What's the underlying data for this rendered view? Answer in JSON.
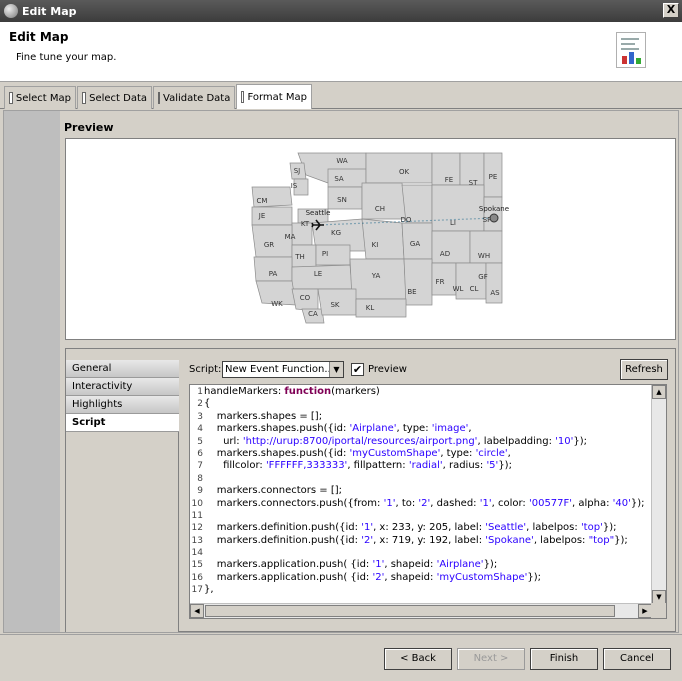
{
  "window": {
    "title": "Edit Map",
    "close_glyph": "X"
  },
  "header": {
    "title": "Edit Map",
    "subtitle": "Fine tune your map."
  },
  "tabs": [
    {
      "label": "Select Map",
      "icon": "select-map-icon"
    },
    {
      "label": "Select Data",
      "icon": "select-data-icon"
    },
    {
      "label": "Validate Data",
      "icon": "validate-data-icon"
    },
    {
      "label": "Format Map",
      "icon": "format-map-icon",
      "active": true
    }
  ],
  "preview": {
    "label": "Preview",
    "map": {
      "region_labels": [
        "WA",
        "SJ",
        "IS",
        "SA",
        "SN",
        "CM",
        "JE",
        "KT",
        "MA",
        "KG",
        "OK",
        "CH",
        "DO",
        "FE",
        "ST",
        "PE",
        "LI",
        "SP",
        "GR",
        "TH",
        "PI",
        "KI",
        "GA",
        "AD",
        "WH",
        "PA",
        "LE",
        "YA",
        "FR",
        "WL",
        "GF",
        "CL",
        "AS",
        "BE",
        "WK",
        "CO",
        "SK",
        "KL",
        "CA"
      ],
      "cities": [
        {
          "name": "Seattle",
          "marker": "airplane"
        },
        {
          "name": "Spokane",
          "marker": "circle"
        }
      ],
      "connector_color": "#00577F"
    }
  },
  "side_nav": {
    "items": [
      {
        "label": "General"
      },
      {
        "label": "Interactivity"
      },
      {
        "label": "Highlights"
      },
      {
        "label": "Script",
        "active": true
      }
    ]
  },
  "script": {
    "label": "Script:",
    "select_value": "New Event Function...",
    "preview_checked": true,
    "preview_label": "Preview",
    "refresh_label": "Refresh",
    "code_lines": [
      {
        "n": "1",
        "text": "handleMarkers: function(markers)"
      },
      {
        "n": "2",
        "text": "{"
      },
      {
        "n": "3",
        "text": "    markers.shapes = [];"
      },
      {
        "n": "4",
        "text": "    markers.shapes.push({id: 'Airplane', type: 'image',"
      },
      {
        "n": "5",
        "text": "      url: 'http://urup:8700/iportal/resources/airport.png', labelpadding: '10'});"
      },
      {
        "n": "6",
        "text": "    markers.shapes.push({id: 'myCustomShape', type: 'circle',"
      },
      {
        "n": "7",
        "text": "      fillcolor: 'FFFFFF,333333', fillpattern: 'radial', radius: '5'});"
      },
      {
        "n": "8",
        "text": ""
      },
      {
        "n": "9",
        "text": "    markers.connectors = [];"
      },
      {
        "n": "10",
        "text": "    markers.connectors.push({from: '1', to: '2', dashed: '1', color: '00577F', alpha: '40'});"
      },
      {
        "n": "11",
        "text": ""
      },
      {
        "n": "12",
        "text": "    markers.definition.push({id: '1', x: 233, y: 205, label: 'Seattle', labelpos: 'top'});"
      },
      {
        "n": "13",
        "text": "    markers.definition.push({id: '2', x: 719, y: 192, label: 'Spokane', labelpos: \"top\"});"
      },
      {
        "n": "14",
        "text": ""
      },
      {
        "n": "15",
        "text": "    markers.application.push( {id: '1', shapeid: 'Airplane'});"
      },
      {
        "n": "16",
        "text": "    markers.application.push( {id: '2', shapeid: 'myCustomShape'});"
      },
      {
        "n": "17",
        "text": "},"
      }
    ]
  },
  "footer": {
    "back_label": "< Back",
    "next_label": "Next >",
    "finish_label": "Finish",
    "cancel_label": "Cancel"
  }
}
